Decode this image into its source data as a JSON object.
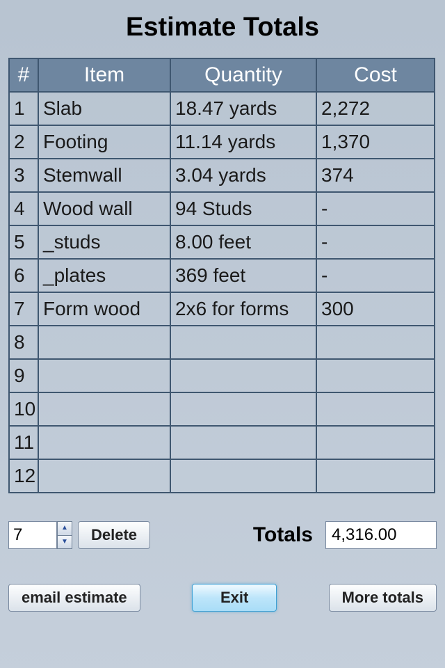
{
  "title": "Estimate Totals",
  "columns": {
    "num": "#",
    "item": "Item",
    "qty": "Quantity",
    "cost": "Cost"
  },
  "rows": [
    {
      "n": "1",
      "item": "Slab",
      "qty": "18.47 yards",
      "cost": "2,272"
    },
    {
      "n": "2",
      "item": "Footing",
      "qty": "11.14 yards",
      "cost": "1,370"
    },
    {
      "n": "3",
      "item": "Stemwall",
      "qty": "3.04 yards",
      "cost": "374"
    },
    {
      "n": "4",
      "item": "Wood wall",
      "qty": "94 Studs",
      "cost": "-"
    },
    {
      "n": "5",
      "item": "_studs",
      "qty": "8.00 feet",
      "cost": "-"
    },
    {
      "n": "6",
      "item": "_plates",
      "qty": "369 feet",
      "cost": "-"
    },
    {
      "n": "7",
      "item": "Form wood",
      "qty": "2x6 for forms",
      "cost": "300"
    },
    {
      "n": "8",
      "item": "",
      "qty": "",
      "cost": ""
    },
    {
      "n": "9",
      "item": "",
      "qty": "",
      "cost": ""
    },
    {
      "n": "10",
      "item": "",
      "qty": "",
      "cost": ""
    },
    {
      "n": "11",
      "item": "",
      "qty": "",
      "cost": ""
    },
    {
      "n": "12",
      "item": "",
      "qty": "",
      "cost": ""
    }
  ],
  "controls": {
    "spinner_value": "7",
    "delete_label": "Delete",
    "totals_label": "Totals",
    "totals_value": "4,316.00",
    "email_label": "email estimate",
    "exit_label": "Exit",
    "more_label": "More totals"
  }
}
